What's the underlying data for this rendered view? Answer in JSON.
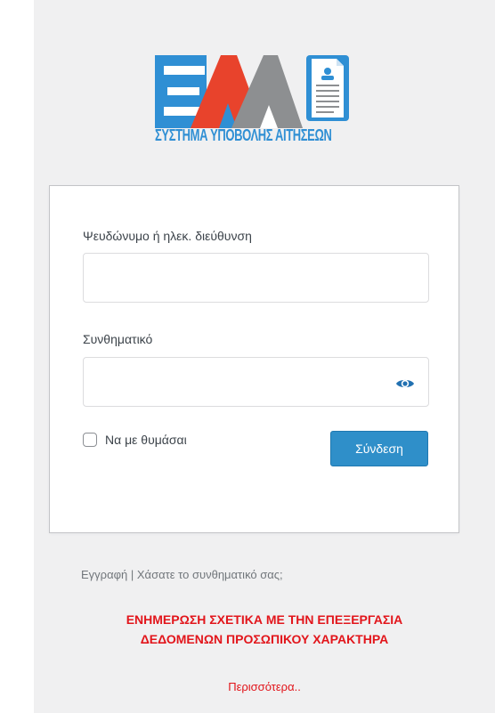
{
  "logo": {
    "tagline": "ΣΥΣΤΗΜΑ ΥΠΟΒΟΛΗΣ ΑΙΤΗΣΕΩΝ",
    "letters": "ΕΛΔ",
    "colors": {
      "blue": "#2f8fd4",
      "red": "#e8432c",
      "grey": "#8d8f91"
    }
  },
  "login": {
    "username_label": "Ψευδώνυμο ή ηλεκ. διεύθυνση",
    "username_value": "",
    "password_label": "Συνθηματικό",
    "password_value": "",
    "show_password_icon": "eye-icon",
    "remember_label": "Να με θυμάσαι",
    "remember_checked": false,
    "submit_label": "Σύνδεση"
  },
  "nav": {
    "register": "Εγγραφή",
    "separator": "|",
    "lost_password": "Χάσατε το συνθηματικό σας;"
  },
  "privacy_notice": {
    "line1": "ΕΝΗΜΕΡΩΣΗ ΣΧΕΤΙΚΑ ΜΕ ΤΗΝ ΕΠΕΞΕΡΓΑΣΙΑ",
    "line2": "ΔΕΔΟΜΕΝΩΝ ΠΡΟΣΩΠΙΚΟΥ ΧΑΡΑΚΤΗΡΑ",
    "more_link": "Περισσότερα.."
  },
  "colors": {
    "accent": "#2f8fc9",
    "notice": "#e2151b",
    "background": "#f0f0f1"
  }
}
